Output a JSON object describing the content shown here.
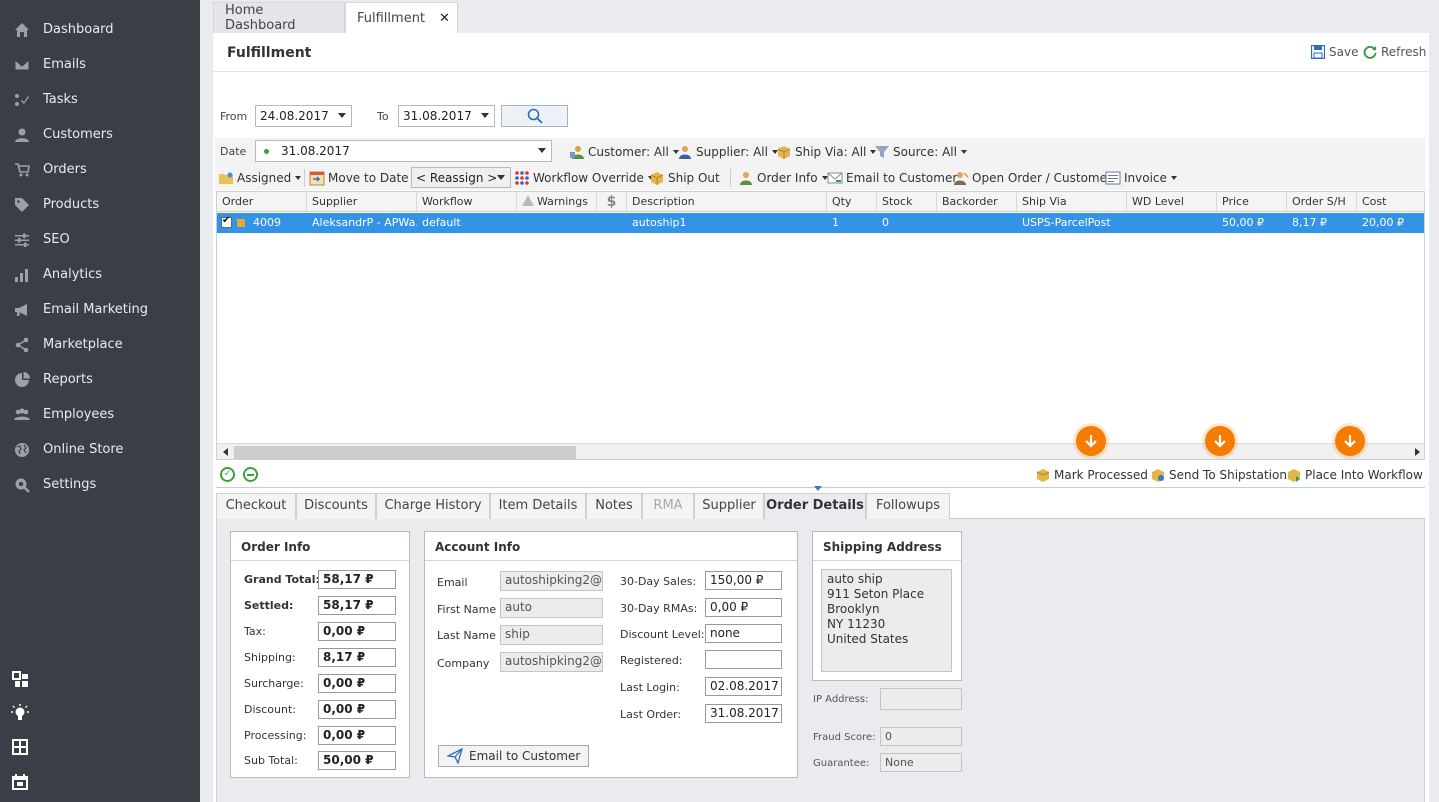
{
  "sidebar": {
    "items": [
      {
        "label": "Dashboard",
        "icon": "home-icon"
      },
      {
        "label": "Emails",
        "icon": "envelope-icon"
      },
      {
        "label": "Tasks",
        "icon": "tasks-icon"
      },
      {
        "label": "Customers",
        "icon": "user-icon"
      },
      {
        "label": "Orders",
        "icon": "cart-icon"
      },
      {
        "label": "Products",
        "icon": "tag-icon"
      },
      {
        "label": "SEO",
        "icon": "sliders-icon"
      },
      {
        "label": "Analytics",
        "icon": "bar-chart-icon"
      },
      {
        "label": "Email Marketing",
        "icon": "megaphone-icon"
      },
      {
        "label": "Marketplace",
        "icon": "share-icon"
      },
      {
        "label": "Reports",
        "icon": "pie-chart-icon"
      },
      {
        "label": "Employees",
        "icon": "users-icon"
      },
      {
        "label": "Online Store",
        "icon": "globe-icon"
      },
      {
        "label": "Settings",
        "icon": "gear-icon"
      }
    ],
    "bottom_icons": [
      "widgets-icon",
      "lightbulb-icon",
      "calculator-icon",
      "calendar-icon"
    ]
  },
  "tabs": [
    {
      "label": "Home Dashboard",
      "active": false
    },
    {
      "label": "Fulfillment",
      "active": true,
      "close": "✕"
    }
  ],
  "header": {
    "title": "Fulfillment",
    "save_label": "Save",
    "refresh_label": "Refresh"
  },
  "filters": {
    "from_label": "From",
    "from_value": "24.08.2017",
    "to_label": "To",
    "to_value": "31.08.2017",
    "date_label": "Date",
    "date_value": "31.08.2017",
    "customer": "Customer: All",
    "supplier": "Supplier: All",
    "ship_via": "Ship Via: All",
    "source": "Source: All"
  },
  "toolbar": {
    "assigned": "Assigned",
    "move_to_date": "Move to Date",
    "reassign": "< Reassign >",
    "workflow_override": "Workflow Override",
    "ship_out": "Ship Out",
    "order_info": "Order Info",
    "email_to_customer": "Email to Customer",
    "open_order_customer": "Open Order / Customer",
    "invoice": "Invoice"
  },
  "grid": {
    "columns": [
      "Order",
      "Supplier",
      "Workflow",
      "Warnings",
      "$",
      "Description",
      "Qty",
      "Stock",
      "Backorder",
      "Ship Via",
      "WD Level",
      "Price",
      "Order S/H",
      "Cost"
    ],
    "rows": [
      {
        "order": "4009",
        "supplier": "AleksandrP - APWa...",
        "workflow": "default",
        "warnings": "",
        "dollar": "",
        "description": "autoship1",
        "qty": "1",
        "stock": "0",
        "backorder": "",
        "ship_via": "USPS-ParcelPost",
        "wd_level": "",
        "price": "50,00 ₽",
        "order_sh": "8,17 ₽",
        "cost": "20,00 ₽"
      }
    ]
  },
  "actions": {
    "mark_processed": "Mark Processed",
    "send_to_shipstation": "Send To Shipstation",
    "place_into_workflow": "Place Into Workflow"
  },
  "detail_tabs": [
    {
      "label": "Checkout"
    },
    {
      "label": "Discounts"
    },
    {
      "label": "Charge History"
    },
    {
      "label": "Item Details"
    },
    {
      "label": "Notes"
    },
    {
      "label": "RMA",
      "disabled": true
    },
    {
      "label": "Supplier"
    },
    {
      "label": "Order Details",
      "active": true
    },
    {
      "label": "Followups"
    }
  ],
  "order_info": {
    "title": "Order Info",
    "fields": [
      {
        "label": "Grand Total:",
        "value": "58,17 ₽",
        "bold": true
      },
      {
        "label": "Settled:",
        "value": "58,17 ₽",
        "bold": true
      },
      {
        "label": "Tax:",
        "value": "0,00 ₽"
      },
      {
        "label": "Shipping:",
        "value": "8,17 ₽"
      },
      {
        "label": "Surcharge:",
        "value": "0,00 ₽"
      },
      {
        "label": "Discount:",
        "value": "0,00 ₽"
      },
      {
        "label": "Processing:",
        "value": "0,00 ₽"
      },
      {
        "label": "Sub Total:",
        "value": "50,00 ₽"
      }
    ]
  },
  "account_info": {
    "title": "Account Info",
    "left": [
      {
        "label": "Email",
        "value": "autoshipking2@"
      },
      {
        "label": "First Name",
        "value": "auto"
      },
      {
        "label": "Last Name",
        "value": "ship"
      },
      {
        "label": "Company",
        "value": "autoshipking2@"
      }
    ],
    "right": [
      {
        "label": "30-Day Sales:",
        "value": "150,00 ₽"
      },
      {
        "label": "30-Day RMAs:",
        "value": "0,00 ₽"
      },
      {
        "label": "Discount Level:",
        "value": "none"
      },
      {
        "label": "Registered:",
        "value": ""
      },
      {
        "label": "Last Login:",
        "value": "02.08.2017"
      },
      {
        "label": "Last Order:",
        "value": "31.08.2017"
      }
    ],
    "email_button": "Email to Customer"
  },
  "shipping": {
    "title": "Shipping Address",
    "lines": [
      "auto ship",
      "911 Seton Place",
      "Brooklyn",
      "NY 11230",
      "United States"
    ],
    "ip_label": "IP Address:",
    "ip_value": "",
    "fraud_label": "Fraud Score:",
    "fraud_value": "0",
    "guarantee_label": "Guarantee:",
    "guarantee_value": "None"
  },
  "colors": {
    "sidebar": "#3a3f47",
    "selected_row": "#3393e6",
    "accent_orange": "#f57c00"
  }
}
